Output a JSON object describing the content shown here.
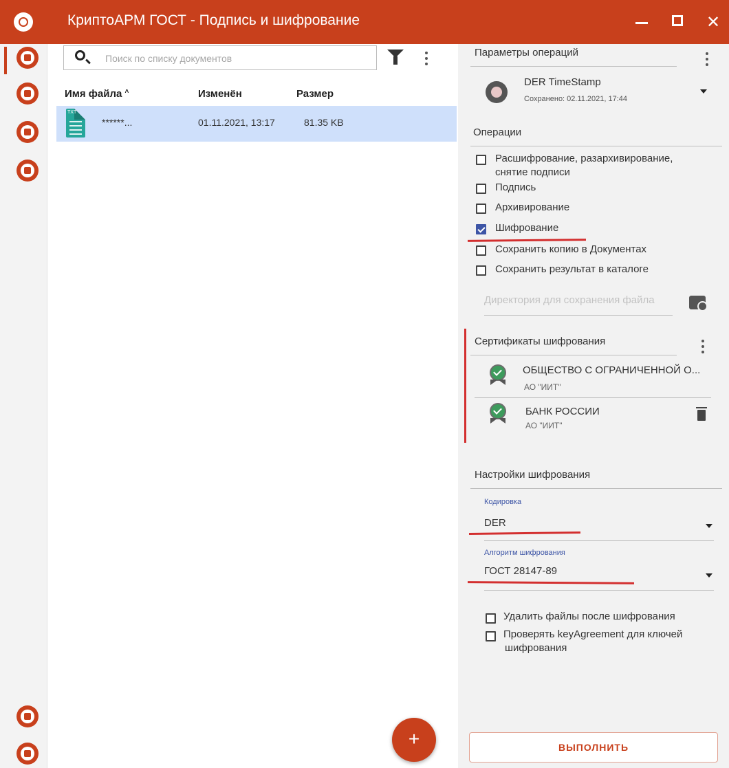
{
  "window": {
    "title": "КриптоАРМ ГОСТ - Подпись и шифрование"
  },
  "search": {
    "placeholder": "Поиск по списку документов"
  },
  "file_table": {
    "columns": [
      "Имя файла",
      "Изменён",
      "Размер"
    ],
    "sort_indicator": "˄",
    "rows": [
      {
        "name": "******...",
        "modified": "01.11.2021, 13:17",
        "size": "81.35 KB",
        "type_label": "TXT",
        "selected": true
      }
    ]
  },
  "fab": {
    "label": "+"
  },
  "params": {
    "heading": "Параметры операций",
    "profile_name": "DER TimeStamp",
    "profile_saved": "Сохранено: 02.11.2021, 17:44"
  },
  "operations": {
    "heading": "Операции",
    "items": [
      {
        "label": "Расшифрование, разархивирование,",
        "label2": "снятие подписи",
        "checked": false
      },
      {
        "label": "Подпись",
        "checked": false
      },
      {
        "label": "Архивирование",
        "checked": false
      },
      {
        "label": "Шифрование",
        "checked": true
      },
      {
        "label": "Сохранить копию в Документах",
        "checked": false
      },
      {
        "label": "Сохранить результат в каталоге",
        "checked": false
      }
    ],
    "dir_placeholder": "Директория для сохранения файла"
  },
  "certs": {
    "heading": "Сертификаты шифрования",
    "items": [
      {
        "name": "ОБЩЕСТВО С ОГРАНИЧЕННОЙ О...",
        "issuer": "АО \"ИИТ\""
      },
      {
        "name": "БАНК РОССИИ",
        "issuer": "АО \"ИИТ\""
      }
    ]
  },
  "enc_settings": {
    "heading": "Настройки шифрования",
    "encoding_label": "Кодировка",
    "encoding_value": "DER",
    "algorithm_label": "Алгоритм шифрования",
    "algorithm_value": "ГОСТ 28147-89",
    "options": [
      {
        "label": "Удалить файлы после шифрования",
        "checked": false
      },
      {
        "label": "Проверять keyAgreement для ключей",
        "label2": "шифрования",
        "checked": false
      }
    ]
  },
  "run_button": {
    "label": "ВЫПОЛНИТЬ"
  },
  "colors": {
    "brand": "#c8401c",
    "selection": "#cfe0fb",
    "checkbox_checked": "#3d55a6",
    "annotation_red": "#d32f2f"
  },
  "icons": [
    "app-logo-icon",
    "sign-icon",
    "documents-icon",
    "certificates-icon",
    "contacts-icon",
    "events-icon",
    "exit-icon",
    "search-icon",
    "filter-icon",
    "more-vert-icon",
    "gear-icon",
    "dropdown-arrow-icon",
    "folder-icon",
    "certificate-icon",
    "trash-icon",
    "txt-file-icon"
  ]
}
